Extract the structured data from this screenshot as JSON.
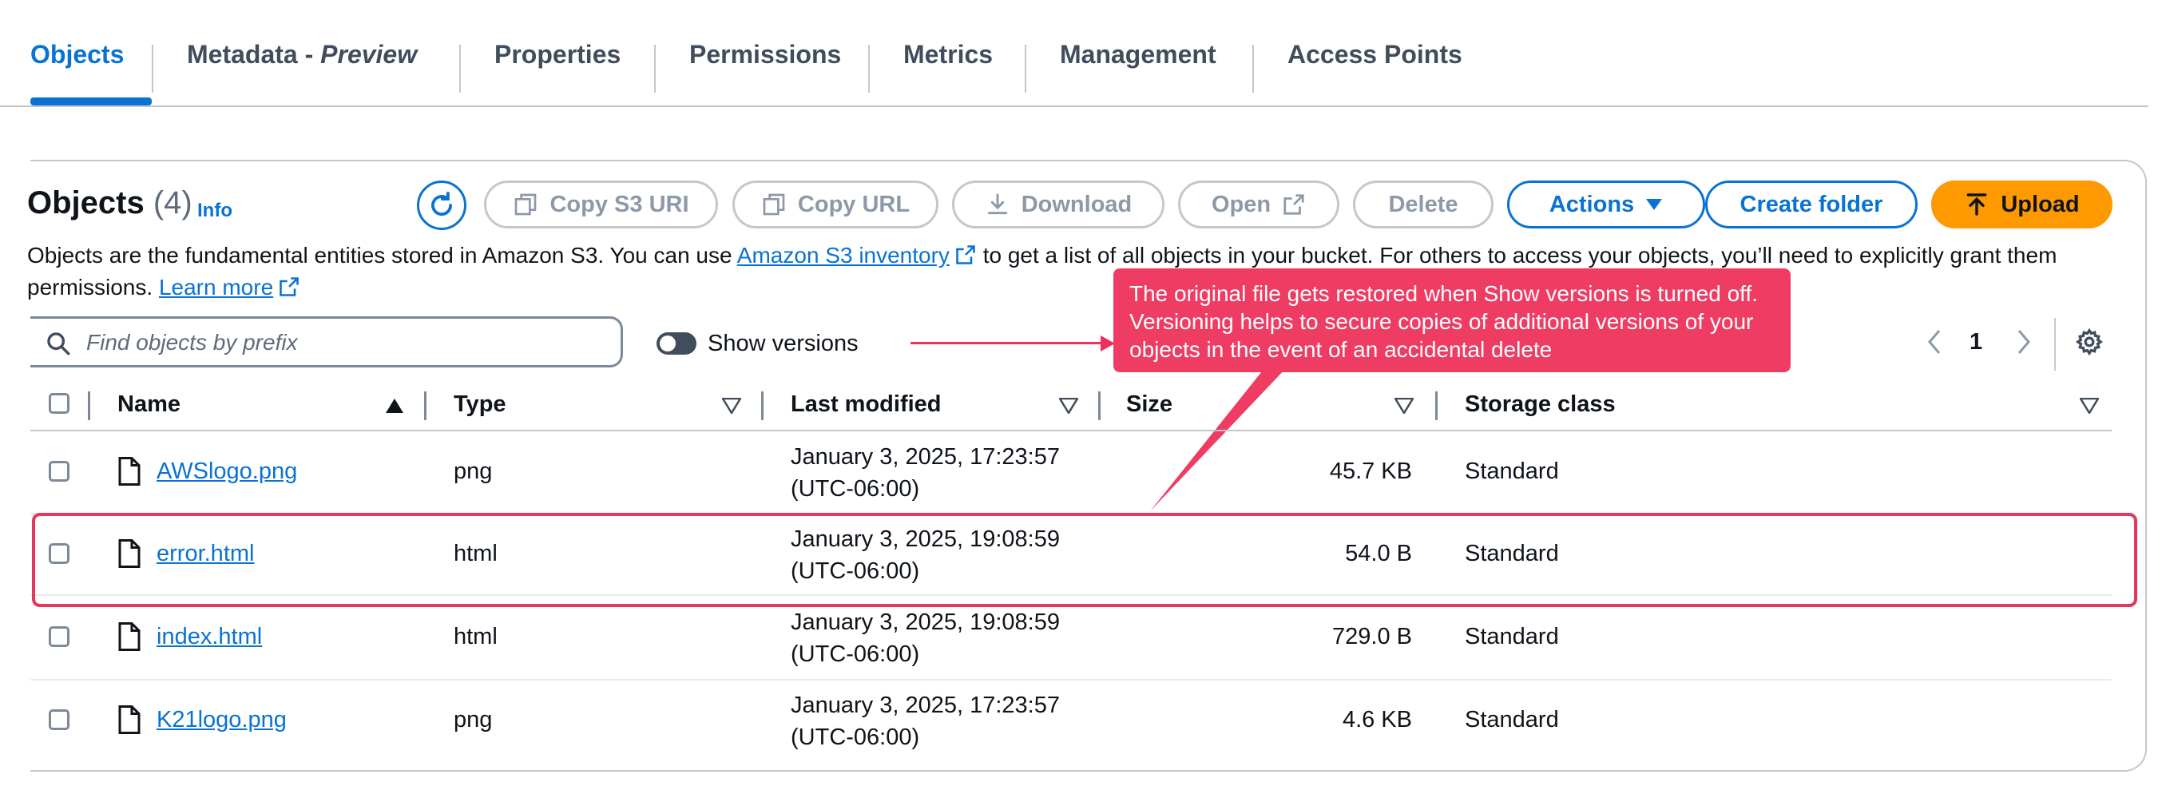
{
  "tabs": [
    {
      "label": "Objects",
      "active": true
    },
    {
      "label": "Metadata - ",
      "label_suffix": "Preview"
    },
    {
      "label": "Properties"
    },
    {
      "label": "Permissions"
    },
    {
      "label": "Metrics"
    },
    {
      "label": "Management"
    },
    {
      "label": "Access Points"
    }
  ],
  "panel": {
    "title": "Objects",
    "count": "(4)",
    "info": "Info",
    "description_1": "Objects are the fundamental entities stored in Amazon S3. You can use",
    "inventory_link": "Amazon S3 inventory",
    "description_2": "to get a list of all objects in your bucket. For others to access your objects, you’ll need to explicitly grant",
    "description_3": "them permissions.",
    "learn_more": "Learn more"
  },
  "toolbar": {
    "copy_s3_uri": "Copy S3 URI",
    "copy_url": "Copy URL",
    "download": "Download",
    "open": "Open",
    "delete": "Delete",
    "actions": "Actions",
    "create_folder": "Create folder",
    "upload": "Upload"
  },
  "search": {
    "placeholder": "Find objects by prefix"
  },
  "show_versions": {
    "label": "Show versions",
    "enabled": false
  },
  "callout": "The original file gets restored when Show versions is turned off. Versioning helps to secure copies of additional versions of your objects in the event of an accidental delete",
  "pagination": {
    "page": "1"
  },
  "table": {
    "columns": [
      "Name",
      "Type",
      "Last modified",
      "Size",
      "Storage class"
    ],
    "rows": [
      {
        "name": "AWSlogo.png",
        "type": "png",
        "modified_1": "January 3, 2025, 17:23:57",
        "modified_2": "(UTC-06:00)",
        "size": "45.7 KB",
        "storage": "Standard"
      },
      {
        "name": "error.html",
        "type": "html",
        "modified_1": "January 3, 2025, 19:08:59",
        "modified_2": "(UTC-06:00)",
        "size": "54.0 B",
        "storage": "Standard"
      },
      {
        "name": "index.html",
        "type": "html",
        "modified_1": "January 3, 2025, 19:08:59",
        "modified_2": "(UTC-06:00)",
        "size": "729.0 B",
        "storage": "Standard"
      },
      {
        "name": "K21logo.png",
        "type": "png",
        "modified_1": "January 3, 2025, 17:23:57",
        "modified_2": "(UTC-06:00)",
        "size": "4.6 KB",
        "storage": "Standard"
      }
    ]
  },
  "colors": {
    "accent": "#0972d3",
    "upload": "#ff9900",
    "annotation": "#ef3c63"
  }
}
